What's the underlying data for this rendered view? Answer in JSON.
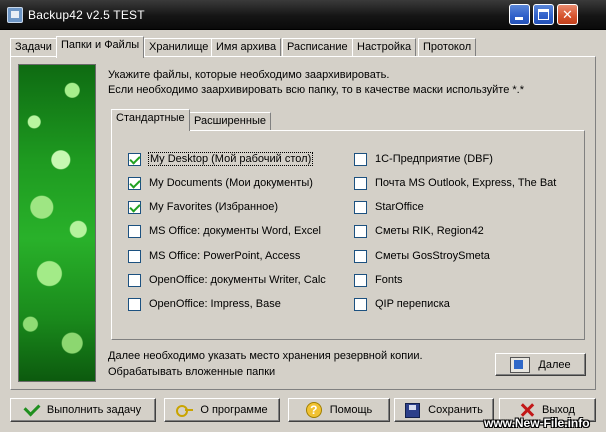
{
  "window": {
    "title": "Backup42 v2.5    TEST"
  },
  "tabs": [
    {
      "label": "Задачи",
      "active": false
    },
    {
      "label": "Папки и Файлы",
      "active": true
    },
    {
      "label": "Хранилище",
      "active": false
    },
    {
      "label": "Имя архива",
      "active": false
    },
    {
      "label": "Расписание",
      "active": false
    },
    {
      "label": "Настройка",
      "active": false
    },
    {
      "label": "Протокол",
      "active": false
    }
  ],
  "intro": {
    "line1": "Укажите файлы, которые необходимо заархивировать.",
    "line2": "Если необходимо заархивировать всю папку, то в качестве маски используйте *.*"
  },
  "subtabs": [
    {
      "label": "Стандартные",
      "active": true
    },
    {
      "label": "Расширенные",
      "active": false
    }
  ],
  "left_items": [
    {
      "label": "My Desktop (Мой рабочий стол)",
      "checked": true
    },
    {
      "label": "My Documents (Мои документы)",
      "checked": true
    },
    {
      "label": "My Favorites (Избранное)",
      "checked": true
    },
    {
      "label": "MS Office: документы Word, Excel",
      "checked": false
    },
    {
      "label": "MS Office: PowerPoint, Access",
      "checked": false
    },
    {
      "label": "OpenOffice: документы Writer, Calc",
      "checked": false
    },
    {
      "label": "OpenOffice: Impress, Base",
      "checked": false
    }
  ],
  "right_items": [
    {
      "label": "1С-Предприятие (DBF)",
      "checked": false
    },
    {
      "label": "Почта MS Outlook, Express, The Bat",
      "checked": false
    },
    {
      "label": "StarOffice",
      "checked": false
    },
    {
      "label": "Сметы RIK, Region42",
      "checked": false
    },
    {
      "label": "Сметы GosStroySmeta",
      "checked": false
    },
    {
      "label": "Fonts",
      "checked": false
    },
    {
      "label": "QIP переписка",
      "checked": false
    }
  ],
  "note": {
    "line1": "Далее необходимо указать место хранения резервной копии.",
    "line2": "Обрабатывать вложенные папки"
  },
  "next_label": "Далее",
  "buttons": {
    "run": "Выполнить задачу",
    "about": "О программе",
    "help": "Помощь",
    "save": "Сохранить",
    "exit": "Выход"
  },
  "watermark": "www.New-File.info"
}
